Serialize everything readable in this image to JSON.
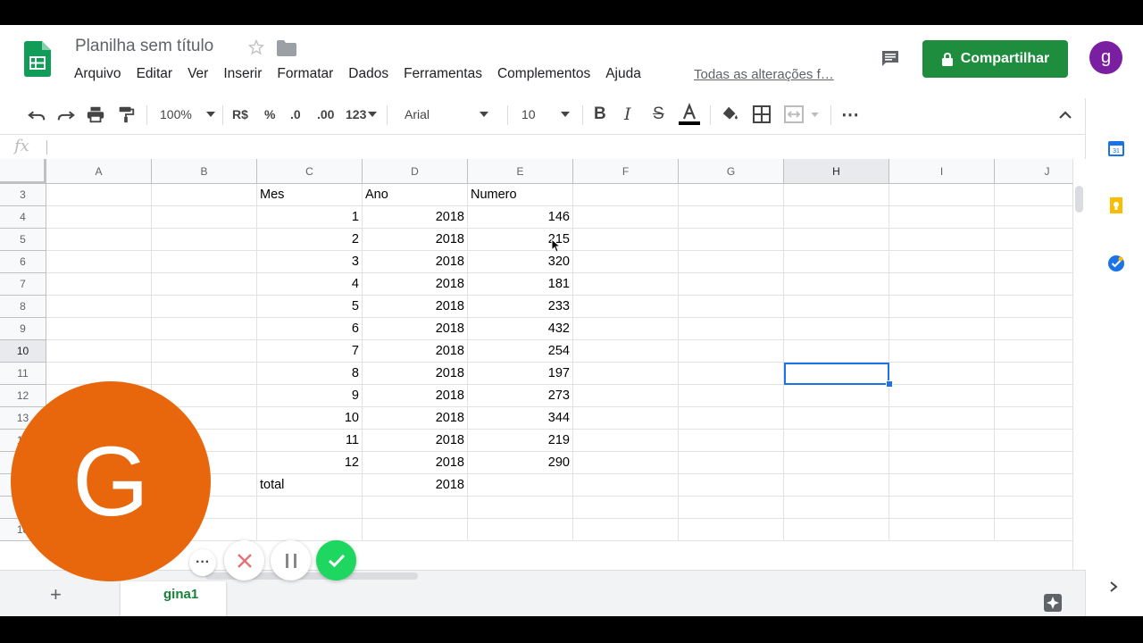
{
  "app": {
    "doc_title": "Planilha sem título",
    "menu": [
      "Arquivo",
      "Editar",
      "Ver",
      "Inserir",
      "Formatar",
      "Dados",
      "Ferramentas",
      "Complementos",
      "Ajuda"
    ],
    "saved_status": "Todas as alterações f…",
    "share_label": "Compartilhar",
    "account_initial": "g"
  },
  "toolbar": {
    "zoom": "100%",
    "currency": "R$",
    "percent": "%",
    "decrease_decimals": ".0",
    "increase_decimals": ".00",
    "number_format": "123",
    "font": "Arial",
    "font_size": "10",
    "more": "⋯"
  },
  "formula_bar": {
    "fx": "fx",
    "value": ""
  },
  "grid": {
    "columns": [
      "A",
      "B",
      "C",
      "D",
      "E",
      "F",
      "G",
      "H",
      "I",
      "J"
    ],
    "rows": [
      {
        "n": "3",
        "C": "Mes",
        "D": "Ano",
        "E": "Numero"
      },
      {
        "n": "4",
        "C": "1",
        "D": "2018",
        "E": "146"
      },
      {
        "n": "5",
        "C": "2",
        "D": "2018",
        "E": "215"
      },
      {
        "n": "6",
        "C": "3",
        "D": "2018",
        "E": "320"
      },
      {
        "n": "7",
        "C": "4",
        "D": "2018",
        "E": "181"
      },
      {
        "n": "8",
        "C": "5",
        "D": "2018",
        "E": "233"
      },
      {
        "n": "9",
        "C": "6",
        "D": "2018",
        "E": "432"
      },
      {
        "n": "10",
        "C": "7",
        "D": "2018",
        "E": "254"
      },
      {
        "n": "11",
        "C": "8",
        "D": "2018",
        "E": "197"
      },
      {
        "n": "12",
        "C": "9",
        "D": "2018",
        "E": "273"
      },
      {
        "n": "13",
        "C": "10",
        "D": "2018",
        "E": "344"
      },
      {
        "n": "14",
        "C": "11",
        "D": "2018",
        "E": "219"
      },
      {
        "n": "15",
        "C": "12",
        "D": "2018",
        "E": "290"
      },
      {
        "n": "16",
        "C": "total",
        "D": "2018",
        "E": ""
      },
      {
        "n": "17",
        "C": "",
        "D": "",
        "E": ""
      },
      {
        "n": "18",
        "C": "",
        "D": "",
        "E": ""
      }
    ],
    "active_cell": "H10"
  },
  "sheets": {
    "active_tab": "Página1",
    "visible_tab_text": "gina1"
  },
  "recorder": {
    "avatar_letter": "G",
    "avatar_color": "#e8670c",
    "done_color": "#1ed760"
  },
  "colors": {
    "share": "#1e8e3e",
    "accent": "#1a73e8",
    "account": "#7b1fa2"
  }
}
